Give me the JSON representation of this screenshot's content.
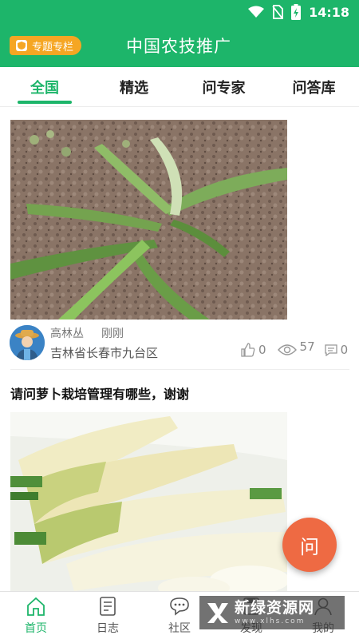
{
  "status_bar": {
    "time": "14:18"
  },
  "header": {
    "special_label": "专题专栏",
    "title": "中国农技推广"
  },
  "tabs": [
    {
      "label": "全国",
      "active": true
    },
    {
      "label": "精选",
      "active": false
    },
    {
      "label": "问专家",
      "active": false
    },
    {
      "label": "问答库",
      "active": false
    }
  ],
  "posts": [
    {
      "author": "高林丛",
      "time": "刚刚",
      "location": "吉林省长春市九台区",
      "likes": "0",
      "views": "57",
      "comments": "0"
    },
    {
      "title": "请问萝卜栽培管理有哪些，谢谢"
    }
  ],
  "fab": {
    "label": "问"
  },
  "bottom_nav": [
    {
      "label": "首页",
      "icon": "home-icon",
      "active": true
    },
    {
      "label": "日志",
      "icon": "log-icon",
      "active": false
    },
    {
      "label": "社区",
      "icon": "chat-icon",
      "active": false
    },
    {
      "label": "发现",
      "icon": "discover-icon",
      "active": false
    },
    {
      "label": "我的",
      "icon": "profile-icon",
      "active": false
    }
  ],
  "watermark": {
    "main": "新绿资源网",
    "sub": "www.xlhs.com"
  },
  "colors": {
    "brand_green": "#1db56a",
    "accent_orange": "#f5a623",
    "fab_orange": "#ee6a43"
  }
}
